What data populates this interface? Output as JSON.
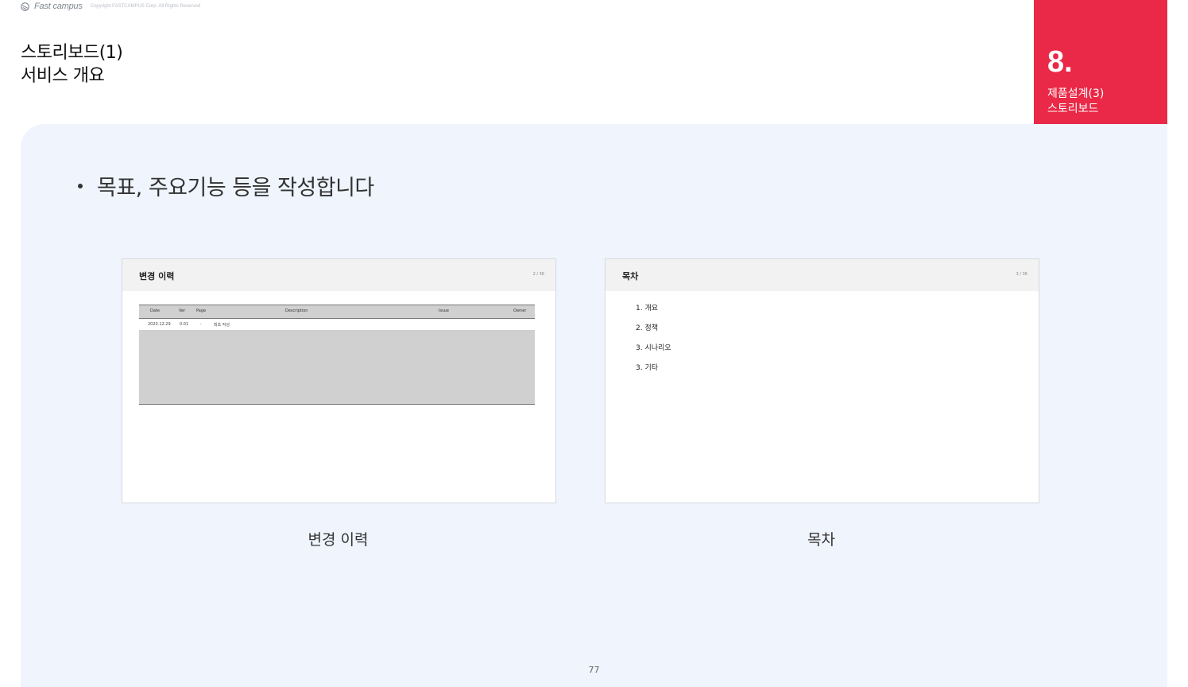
{
  "header": {
    "logo_text": "Fast campus",
    "copyright": "Copyright FASTCAMPUS Corp. All Rights Reserved"
  },
  "title": {
    "line1": "스토리보드(1)",
    "line2": "서비스 개요"
  },
  "chapter": {
    "number": "8",
    "dot": ".",
    "label_line1": "제품설계(3)",
    "label_line2": "스토리보드",
    "color": "#ea2847"
  },
  "content": {
    "bullet": "목표, 주요기능 등을 작성합니다",
    "background": "#eff4fd"
  },
  "thumbnails": [
    {
      "title": "변경 이력",
      "page": "2 / 36",
      "caption": "변경 이력",
      "table": {
        "columns": [
          "Date",
          "Ver",
          "Page",
          "Description",
          "Issue",
          "Owner"
        ],
        "rows": [
          [
            "2020.12.29",
            "0.01",
            "-",
            "최초 작성",
            "",
            ""
          ]
        ]
      }
    },
    {
      "title": "목차",
      "page": "3 / 36",
      "caption": "목차",
      "items": [
        "1. 개요",
        "2. 정책",
        "3. 시나리오",
        "3. 기타"
      ]
    }
  ],
  "footer": {
    "page_number": "77"
  }
}
